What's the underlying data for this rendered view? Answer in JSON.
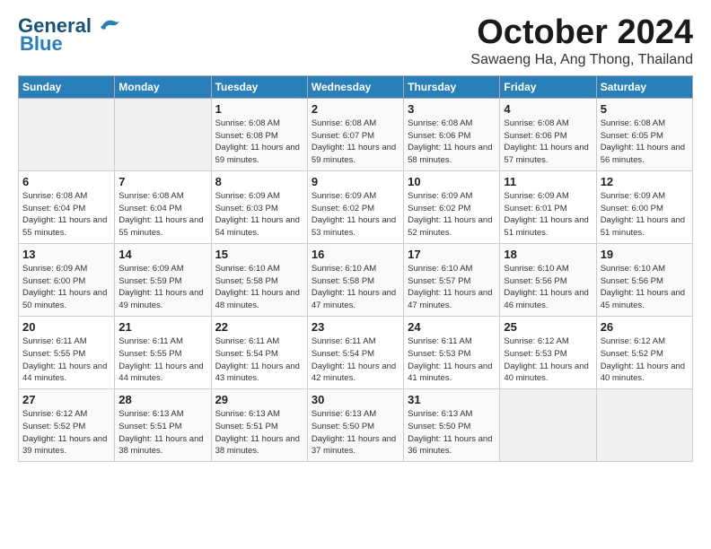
{
  "header": {
    "logo_general": "General",
    "logo_blue": "Blue",
    "month": "October 2024",
    "location": "Sawaeng Ha, Ang Thong, Thailand"
  },
  "days_of_week": [
    "Sunday",
    "Monday",
    "Tuesday",
    "Wednesday",
    "Thursday",
    "Friday",
    "Saturday"
  ],
  "weeks": [
    [
      {
        "day": "",
        "sunrise": "",
        "sunset": "",
        "daylight": ""
      },
      {
        "day": "",
        "sunrise": "",
        "sunset": "",
        "daylight": ""
      },
      {
        "day": "1",
        "sunrise": "Sunrise: 6:08 AM",
        "sunset": "Sunset: 6:08 PM",
        "daylight": "Daylight: 11 hours and 59 minutes."
      },
      {
        "day": "2",
        "sunrise": "Sunrise: 6:08 AM",
        "sunset": "Sunset: 6:07 PM",
        "daylight": "Daylight: 11 hours and 59 minutes."
      },
      {
        "day": "3",
        "sunrise": "Sunrise: 6:08 AM",
        "sunset": "Sunset: 6:06 PM",
        "daylight": "Daylight: 11 hours and 58 minutes."
      },
      {
        "day": "4",
        "sunrise": "Sunrise: 6:08 AM",
        "sunset": "Sunset: 6:06 PM",
        "daylight": "Daylight: 11 hours and 57 minutes."
      },
      {
        "day": "5",
        "sunrise": "Sunrise: 6:08 AM",
        "sunset": "Sunset: 6:05 PM",
        "daylight": "Daylight: 11 hours and 56 minutes."
      }
    ],
    [
      {
        "day": "6",
        "sunrise": "Sunrise: 6:08 AM",
        "sunset": "Sunset: 6:04 PM",
        "daylight": "Daylight: 11 hours and 55 minutes."
      },
      {
        "day": "7",
        "sunrise": "Sunrise: 6:08 AM",
        "sunset": "Sunset: 6:04 PM",
        "daylight": "Daylight: 11 hours and 55 minutes."
      },
      {
        "day": "8",
        "sunrise": "Sunrise: 6:09 AM",
        "sunset": "Sunset: 6:03 PM",
        "daylight": "Daylight: 11 hours and 54 minutes."
      },
      {
        "day": "9",
        "sunrise": "Sunrise: 6:09 AM",
        "sunset": "Sunset: 6:02 PM",
        "daylight": "Daylight: 11 hours and 53 minutes."
      },
      {
        "day": "10",
        "sunrise": "Sunrise: 6:09 AM",
        "sunset": "Sunset: 6:02 PM",
        "daylight": "Daylight: 11 hours and 52 minutes."
      },
      {
        "day": "11",
        "sunrise": "Sunrise: 6:09 AM",
        "sunset": "Sunset: 6:01 PM",
        "daylight": "Daylight: 11 hours and 51 minutes."
      },
      {
        "day": "12",
        "sunrise": "Sunrise: 6:09 AM",
        "sunset": "Sunset: 6:00 PM",
        "daylight": "Daylight: 11 hours and 51 minutes."
      }
    ],
    [
      {
        "day": "13",
        "sunrise": "Sunrise: 6:09 AM",
        "sunset": "Sunset: 6:00 PM",
        "daylight": "Daylight: 11 hours and 50 minutes."
      },
      {
        "day": "14",
        "sunrise": "Sunrise: 6:09 AM",
        "sunset": "Sunset: 5:59 PM",
        "daylight": "Daylight: 11 hours and 49 minutes."
      },
      {
        "day": "15",
        "sunrise": "Sunrise: 6:10 AM",
        "sunset": "Sunset: 5:58 PM",
        "daylight": "Daylight: 11 hours and 48 minutes."
      },
      {
        "day": "16",
        "sunrise": "Sunrise: 6:10 AM",
        "sunset": "Sunset: 5:58 PM",
        "daylight": "Daylight: 11 hours and 47 minutes."
      },
      {
        "day": "17",
        "sunrise": "Sunrise: 6:10 AM",
        "sunset": "Sunset: 5:57 PM",
        "daylight": "Daylight: 11 hours and 47 minutes."
      },
      {
        "day": "18",
        "sunrise": "Sunrise: 6:10 AM",
        "sunset": "Sunset: 5:56 PM",
        "daylight": "Daylight: 11 hours and 46 minutes."
      },
      {
        "day": "19",
        "sunrise": "Sunrise: 6:10 AM",
        "sunset": "Sunset: 5:56 PM",
        "daylight": "Daylight: 11 hours and 45 minutes."
      }
    ],
    [
      {
        "day": "20",
        "sunrise": "Sunrise: 6:11 AM",
        "sunset": "Sunset: 5:55 PM",
        "daylight": "Daylight: 11 hours and 44 minutes."
      },
      {
        "day": "21",
        "sunrise": "Sunrise: 6:11 AM",
        "sunset": "Sunset: 5:55 PM",
        "daylight": "Daylight: 11 hours and 44 minutes."
      },
      {
        "day": "22",
        "sunrise": "Sunrise: 6:11 AM",
        "sunset": "Sunset: 5:54 PM",
        "daylight": "Daylight: 11 hours and 43 minutes."
      },
      {
        "day": "23",
        "sunrise": "Sunrise: 6:11 AM",
        "sunset": "Sunset: 5:54 PM",
        "daylight": "Daylight: 11 hours and 42 minutes."
      },
      {
        "day": "24",
        "sunrise": "Sunrise: 6:11 AM",
        "sunset": "Sunset: 5:53 PM",
        "daylight": "Daylight: 11 hours and 41 minutes."
      },
      {
        "day": "25",
        "sunrise": "Sunrise: 6:12 AM",
        "sunset": "Sunset: 5:53 PM",
        "daylight": "Daylight: 11 hours and 40 minutes."
      },
      {
        "day": "26",
        "sunrise": "Sunrise: 6:12 AM",
        "sunset": "Sunset: 5:52 PM",
        "daylight": "Daylight: 11 hours and 40 minutes."
      }
    ],
    [
      {
        "day": "27",
        "sunrise": "Sunrise: 6:12 AM",
        "sunset": "Sunset: 5:52 PM",
        "daylight": "Daylight: 11 hours and 39 minutes."
      },
      {
        "day": "28",
        "sunrise": "Sunrise: 6:13 AM",
        "sunset": "Sunset: 5:51 PM",
        "daylight": "Daylight: 11 hours and 38 minutes."
      },
      {
        "day": "29",
        "sunrise": "Sunrise: 6:13 AM",
        "sunset": "Sunset: 5:51 PM",
        "daylight": "Daylight: 11 hours and 38 minutes."
      },
      {
        "day": "30",
        "sunrise": "Sunrise: 6:13 AM",
        "sunset": "Sunset: 5:50 PM",
        "daylight": "Daylight: 11 hours and 37 minutes."
      },
      {
        "day": "31",
        "sunrise": "Sunrise: 6:13 AM",
        "sunset": "Sunset: 5:50 PM",
        "daylight": "Daylight: 11 hours and 36 minutes."
      },
      {
        "day": "",
        "sunrise": "",
        "sunset": "",
        "daylight": ""
      },
      {
        "day": "",
        "sunrise": "",
        "sunset": "",
        "daylight": ""
      }
    ]
  ]
}
